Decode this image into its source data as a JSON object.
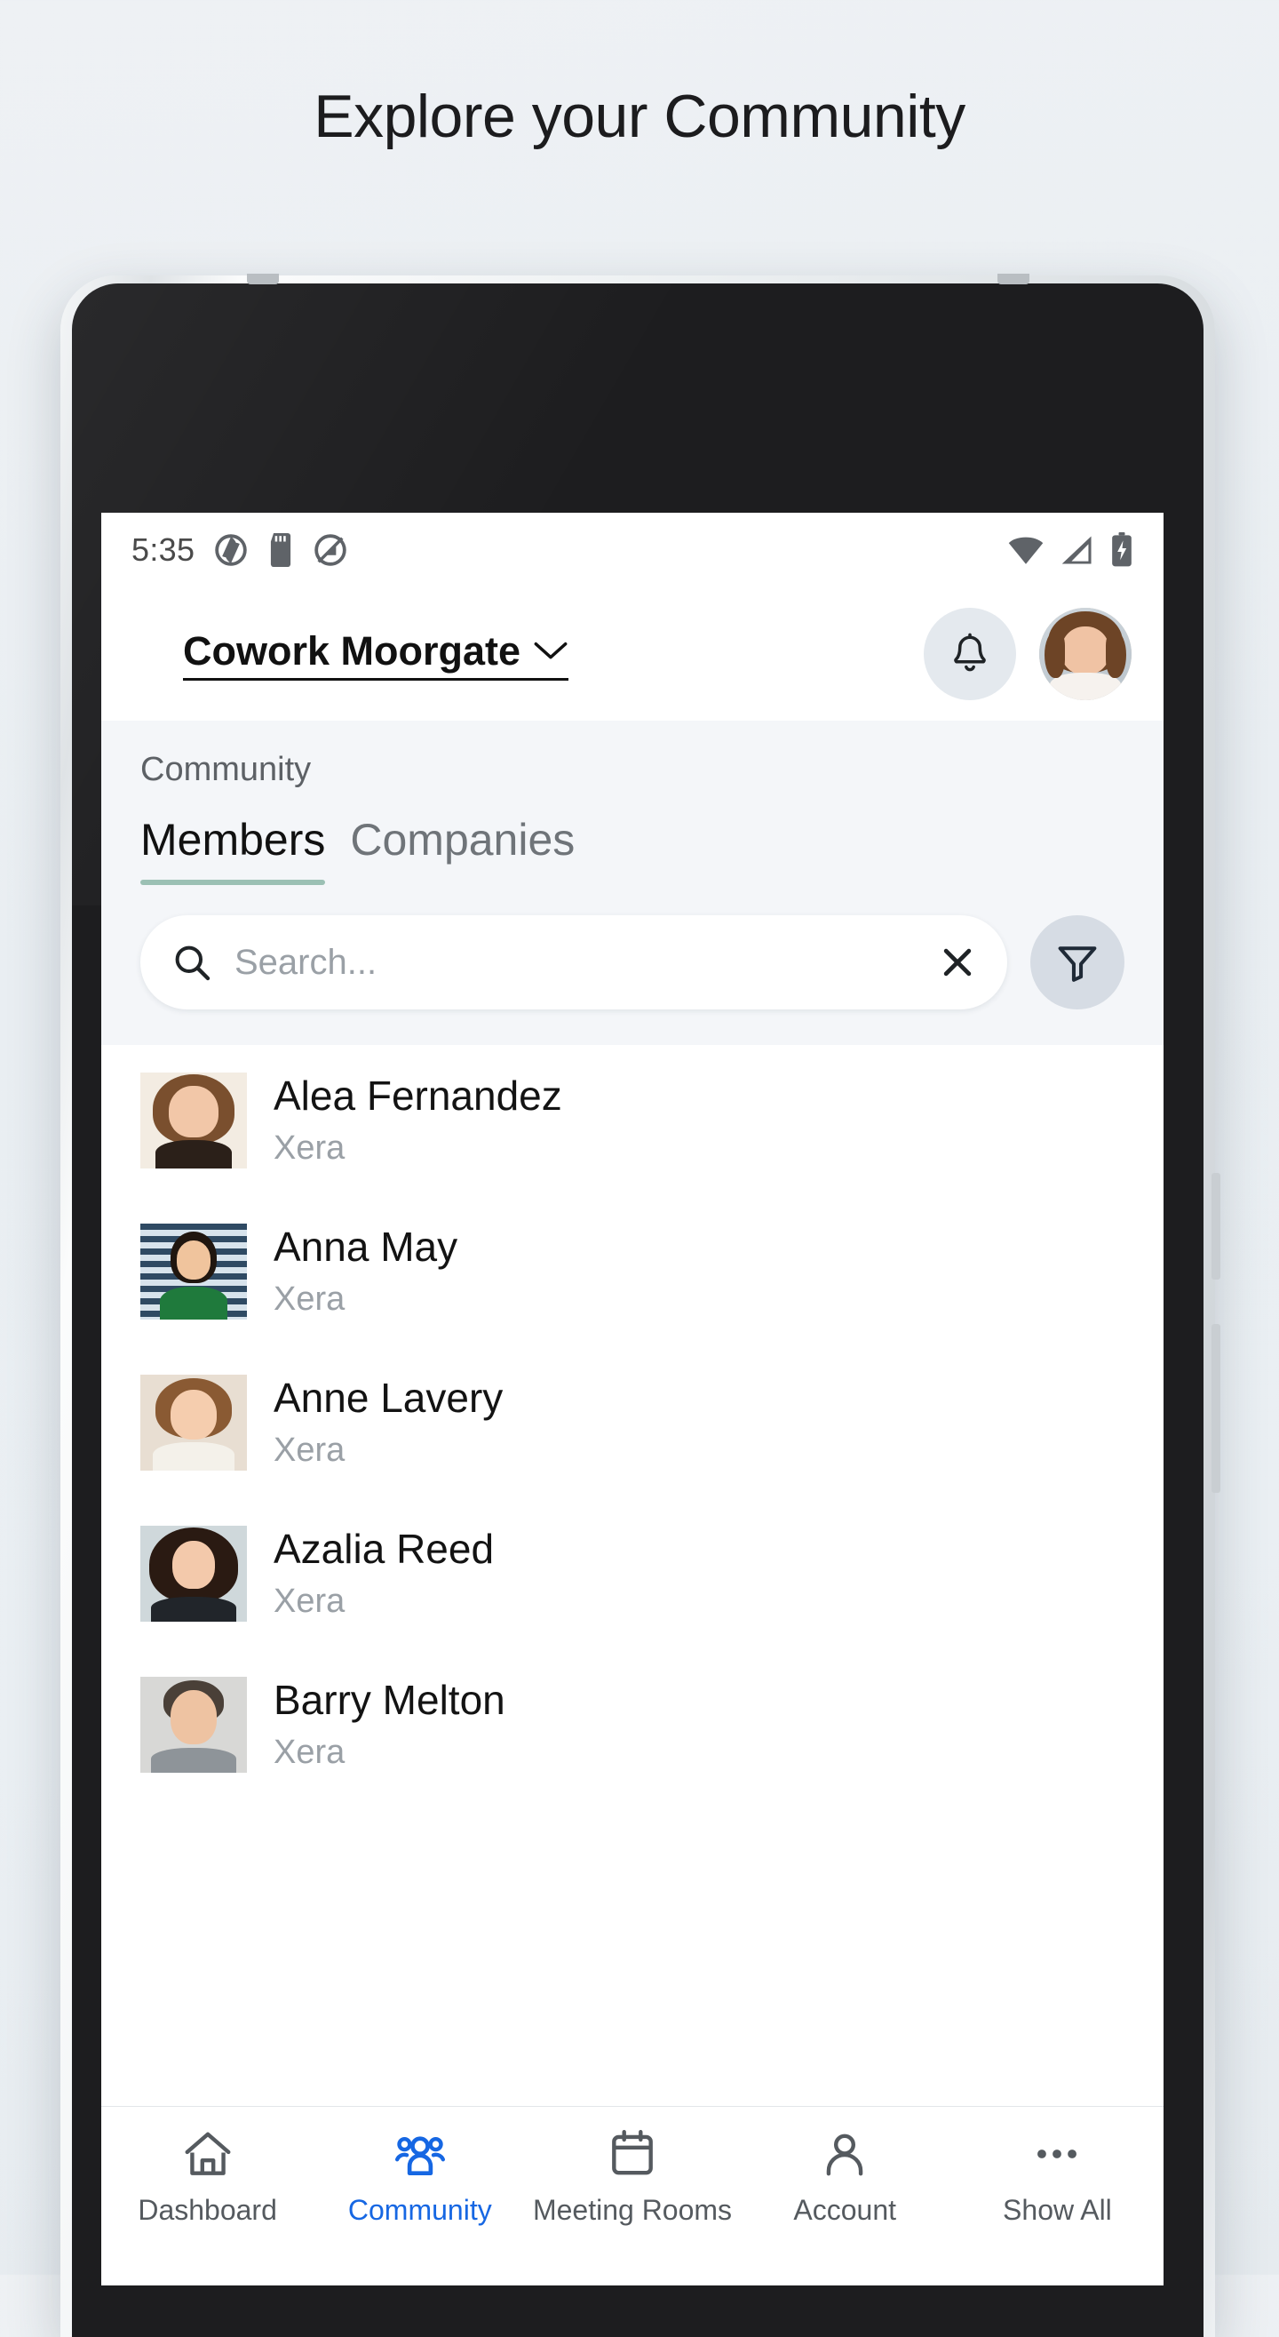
{
  "promo": {
    "headline": "Explore your Community"
  },
  "statusbar": {
    "time": "5:35",
    "left_icons": [
      "camera-shutter-icon",
      "sd-card-icon",
      "do-not-disturb-icon"
    ],
    "right_icons": [
      "wifi-icon",
      "cellular-signal-icon",
      "battery-charging-icon"
    ]
  },
  "header": {
    "venue": "Cowork Moorgate",
    "chevron": "⌄",
    "notifications_icon": "bell-icon",
    "avatar_label": "user-avatar"
  },
  "section": {
    "title": "Community",
    "tabs": [
      {
        "label": "Members",
        "active": true
      },
      {
        "label": "Companies",
        "active": false
      }
    ],
    "search": {
      "placeholder": "Search...",
      "value": "",
      "search_icon": "search-icon",
      "clear_icon": "close-icon"
    },
    "filter_icon": "filter-icon"
  },
  "members": [
    {
      "name": "Alea Fernandez",
      "company": "Xera"
    },
    {
      "name": "Anna May",
      "company": "Xera"
    },
    {
      "name": "Anne Lavery",
      "company": "Xera"
    },
    {
      "name": "Azalia Reed",
      "company": "Xera"
    },
    {
      "name": "Barry Melton",
      "company": "Xera"
    }
  ],
  "bottom_nav": [
    {
      "label": "Dashboard",
      "icon": "home-icon",
      "active": false
    },
    {
      "label": "Community",
      "icon": "people-group-icon",
      "active": true
    },
    {
      "label": "Meeting Rooms",
      "icon": "calendar-icon",
      "active": false
    },
    {
      "label": "Account",
      "icon": "person-icon",
      "active": false
    },
    {
      "label": "Show All",
      "icon": "ellipsis-icon",
      "active": false
    }
  ],
  "colors": {
    "accent_blue": "#1667e3",
    "tab_underline": "#9bc0b4",
    "page_bg": "#eef1f4",
    "panel_bg": "#f4f6f9"
  }
}
